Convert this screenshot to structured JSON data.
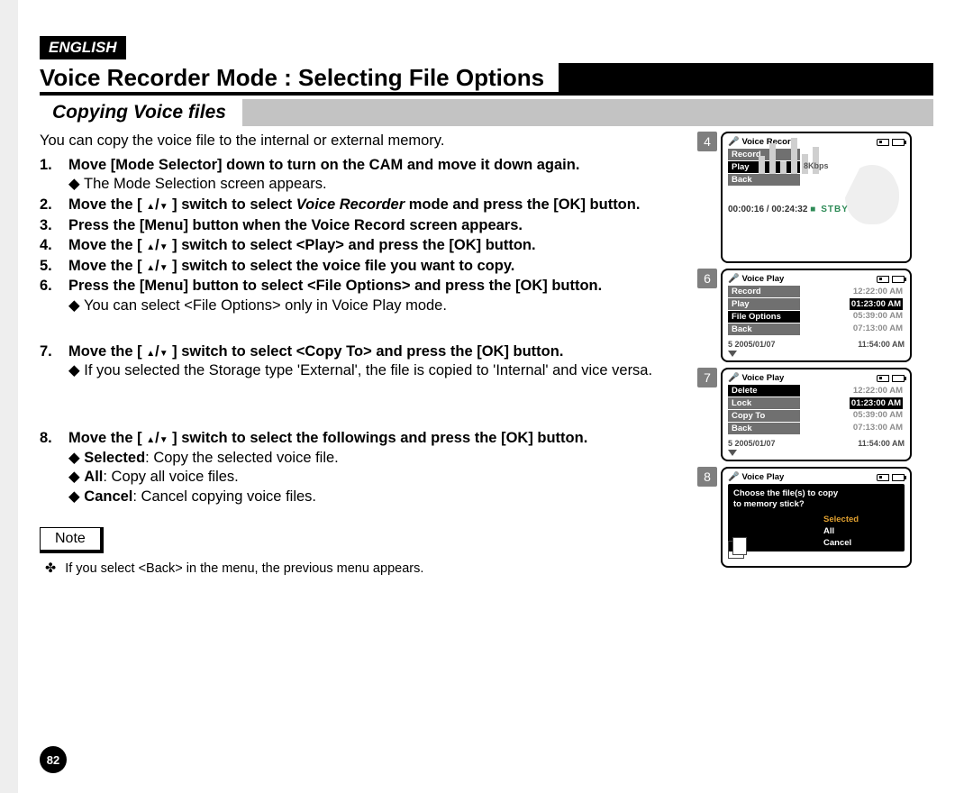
{
  "language_badge": "ENGLISH",
  "page_title": "Voice Recorder Mode : Selecting File Options",
  "subheading": "Copying Voice files",
  "intro": "You can copy the voice file to the internal or external memory.",
  "steps": [
    {
      "n": "1.",
      "main": "Move [Mode Selector] down to turn on the CAM and move it down again.",
      "subs": [
        "The Mode Selection screen appears."
      ]
    },
    {
      "n": "2.",
      "main_pre": "Move the [ ",
      "main_mid": " ] switch to select ",
      "main_em": "Voice Recorder",
      "main_post": " mode and press the [OK] button.",
      "subs": []
    },
    {
      "n": "3.",
      "main": "Press the [Menu] button when the Voice Record screen appears.",
      "subs": []
    },
    {
      "n": "4.",
      "main_pre": "Move the [ ",
      "main_post": " ] switch to select <Play> and press the [OK] button.",
      "subs": []
    },
    {
      "n": "5.",
      "main_pre": "Move the [ ",
      "main_post": " ] switch to select the voice file you want to copy.",
      "subs": []
    },
    {
      "n": "6.",
      "main": "Press the [Menu] button to select <File Options> and press the [OK] button.",
      "subs": [
        "You can select <File Options> only in Voice Play mode."
      ]
    },
    {
      "n": "7.",
      "main_pre": "Move the [ ",
      "main_post": " ] switch to select <Copy To> and press the [OK] button.",
      "subs": [
        "If you selected the Storage type 'External', the file is copied to 'Internal' and vice versa."
      ]
    },
    {
      "n": "8.",
      "main_pre": "Move the [ ",
      "main_post": " ] switch to select the followings and press the [OK] button.",
      "subs_kv": [
        {
          "k": "Selected",
          "v": ": Copy the selected voice file."
        },
        {
          "k": "All",
          "v": ": Copy all voice files."
        },
        {
          "k": "Cancel",
          "v": ": Cancel copying voice files."
        }
      ]
    }
  ],
  "note_label": "Note",
  "note_text": "If you select <Back> in the menu, the previous menu appears.",
  "page_number": "82",
  "screens": {
    "s4": {
      "num": "4",
      "title": "Voice Record",
      "menu": [
        "Record",
        "Play",
        "Back"
      ],
      "menu_sel": 1,
      "side_text": "8Kbps",
      "timebar": "00:00:16 / 00:24:32",
      "stby": "STBY"
    },
    "s6": {
      "num": "6",
      "title": "Voice Play",
      "menu": [
        "Record",
        "Play",
        "File Options",
        "Back"
      ],
      "menu_sel": 2,
      "times": [
        "12:22:00 AM",
        "01:23:00 AM",
        "05:39:00 AM",
        "07:13:00 AM"
      ],
      "times_sel": 1,
      "lowline_a": "5  2005/01/07",
      "lowline_b": "11:54:00 AM"
    },
    "s7": {
      "num": "7",
      "title": "Voice Play",
      "menu": [
        "Delete",
        "Lock",
        "Copy To",
        "Back"
      ],
      "menu_sel": 0,
      "times": [
        "12:22:00 AM",
        "01:23:00 AM",
        "05:39:00 AM",
        "07:13:00 AM"
      ],
      "times_sel": 1,
      "lowline_a": "5  2005/01/07",
      "lowline_b": "11:54:00 AM"
    },
    "s8": {
      "num": "8",
      "title": "Voice Play",
      "prompt1": "Choose the file(s) to copy",
      "prompt2": "to memory stick?",
      "options": [
        "Selected",
        "All",
        "Cancel"
      ],
      "options_sel": 0
    }
  }
}
